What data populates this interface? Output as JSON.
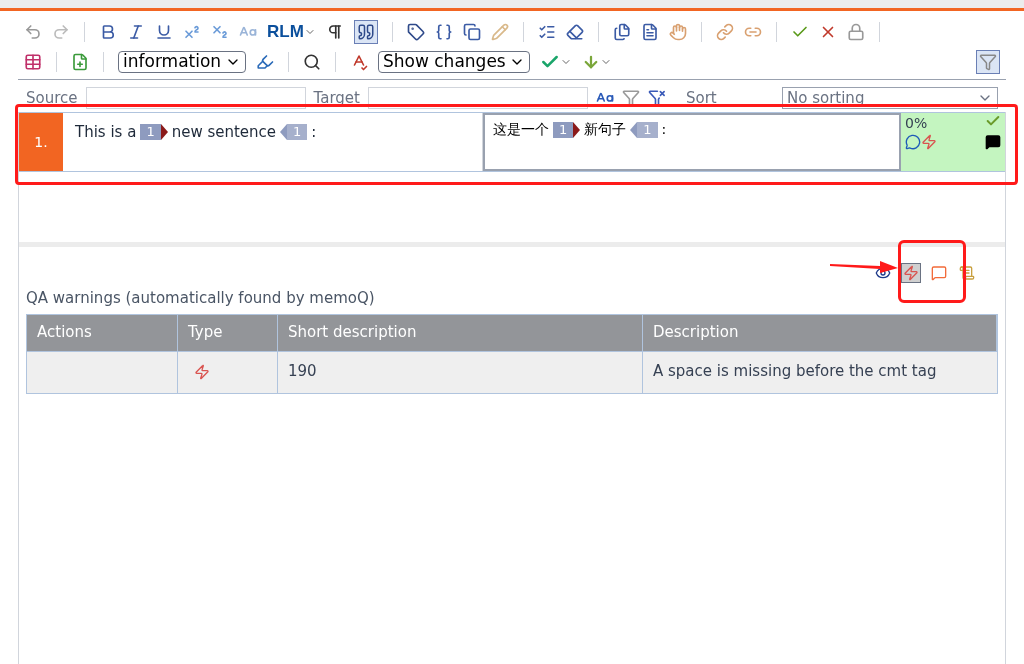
{
  "toolbar": {
    "rlm_label": "RLM",
    "style_select": {
      "value": "information"
    },
    "changes_select": {
      "value": "Show changes"
    },
    "quote_selected": true,
    "filter_selected": true
  },
  "filter_bar": {
    "source_label": "Source",
    "target_label": "Target",
    "sort_label": "Sort",
    "sort_select": {
      "value": "No sorting"
    }
  },
  "segment": {
    "number": "1.",
    "status": "0%",
    "confirmed": true,
    "source": [
      {
        "kind": "text",
        "text": "This is a"
      },
      {
        "kind": "tag_open",
        "text": "1"
      },
      {
        "kind": "text",
        "text": "new sentence"
      },
      {
        "kind": "tag_close",
        "text": "1"
      },
      {
        "kind": "text",
        "text": ":"
      }
    ],
    "target": [
      {
        "kind": "text",
        "text": "这是一个"
      },
      {
        "kind": "tag_open",
        "text": "1"
      },
      {
        "kind": "text",
        "text": "新句子"
      },
      {
        "kind": "tag_close",
        "text": "1"
      },
      {
        "kind": "text",
        "text": ":"
      }
    ]
  },
  "qa_panel": {
    "title": "QA warnings (automatically found by memoQ)",
    "view_buttons": [
      {
        "kind": "eye",
        "selected": false
      },
      {
        "kind": "bolt",
        "selected": true
      },
      {
        "kind": "comment",
        "selected": false
      },
      {
        "kind": "scroll",
        "selected": false
      }
    ],
    "columns": [
      "Actions",
      "Type",
      "Short description",
      "Description"
    ],
    "rows": [
      {
        "kind": "warning",
        "short": "190",
        "description": "A space is missing before the cmt tag"
      }
    ]
  }
}
